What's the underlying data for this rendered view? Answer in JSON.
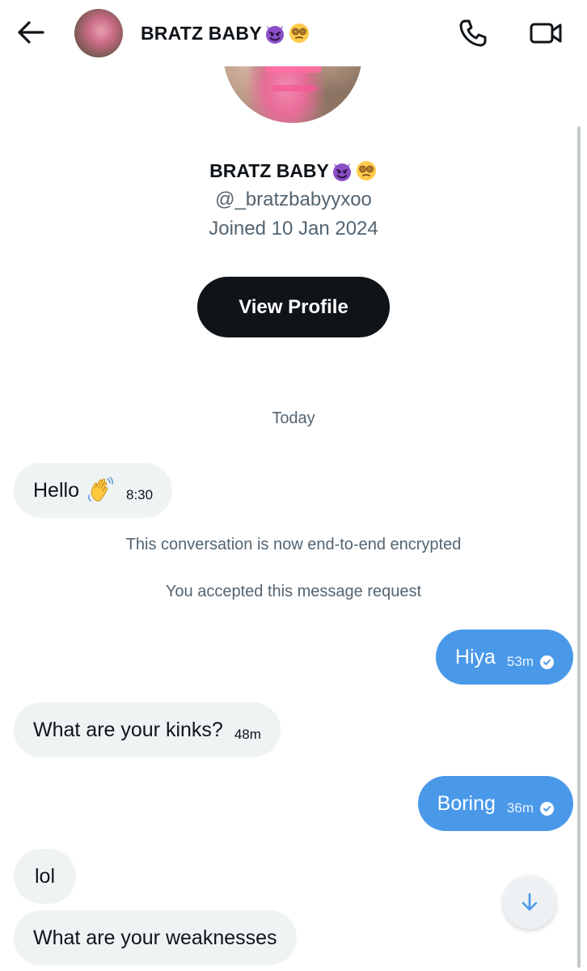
{
  "header": {
    "name": "BRATZ BABY",
    "name_emojis": [
      "smiling-imp-emoji",
      "dizzy-face-emoji"
    ],
    "icons": {
      "back": "arrow-left-icon",
      "call": "phone-icon",
      "video": "video-camera-icon"
    }
  },
  "profile": {
    "name": "BRATZ BABY",
    "handle": "@_bratzbabyyxoo",
    "joined": "Joined 10 Jan 2024",
    "view_profile_label": "View Profile"
  },
  "conversation": {
    "day_label": "Today",
    "messages": [
      {
        "direction": "in",
        "text": "Hello",
        "emoji": "waving-hand-emoji",
        "time": "8:30"
      },
      {
        "direction": "system",
        "text": "This conversation is now end-to-end encrypted"
      },
      {
        "direction": "system",
        "text": "You accepted this message request"
      },
      {
        "direction": "out",
        "text": "Hiya",
        "time": "53m",
        "status": "sent-check-icon"
      },
      {
        "direction": "in",
        "text": "What are your kinks?",
        "time": "48m"
      },
      {
        "direction": "out",
        "text": "Boring",
        "time": "36m",
        "status": "sent-check-icon"
      },
      {
        "direction": "in",
        "text": "lol"
      },
      {
        "direction": "in",
        "text": "What are your weaknesses"
      }
    ]
  },
  "colors": {
    "outgoing_bubble": "#4a99e9",
    "incoming_bubble": "#eff3f4",
    "primary_text": "#0f1419",
    "secondary_text": "#536471",
    "button_bg": "#0f1419"
  },
  "scroll_button_icon": "arrow-down-icon"
}
